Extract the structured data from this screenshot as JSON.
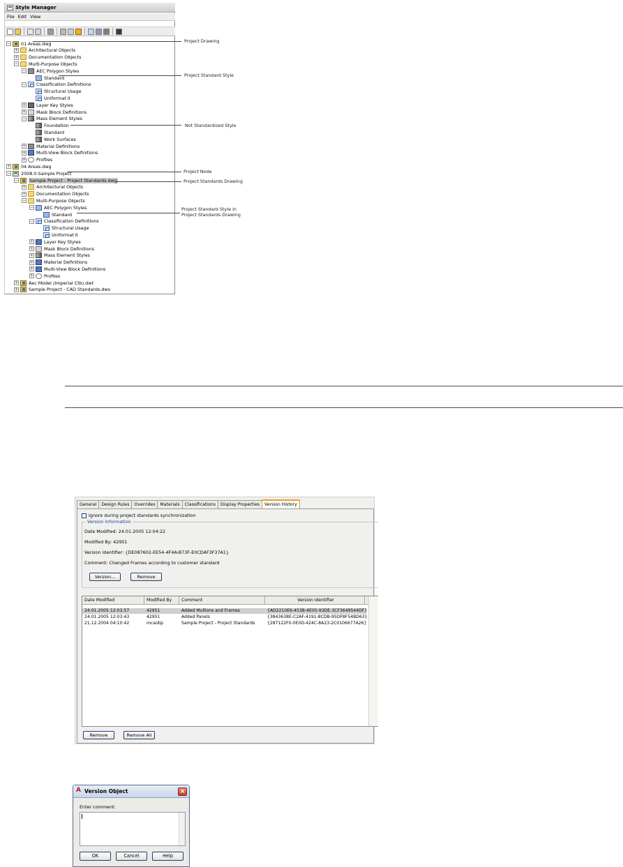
{
  "style_manager": {
    "title": "Style Manager",
    "menu": [
      "File",
      "Edit",
      "View"
    ],
    "tree": [
      {
        "label": "01 Areas.dwg",
        "level": 0,
        "expander": "−",
        "icon": "drawing"
      },
      {
        "label": "Architectural Objects",
        "level": 1,
        "expander": "+",
        "icon": "folder"
      },
      {
        "label": "Documentation Objects",
        "level": 1,
        "expander": "+",
        "icon": "folder"
      },
      {
        "label": "Multi-Purpose Objects",
        "level": 1,
        "expander": "−",
        "icon": "folder"
      },
      {
        "label": "AEC Polygon Styles",
        "level": 2,
        "expander": "−",
        "icon": "grey"
      },
      {
        "label": "Standard",
        "level": 3,
        "expander": "",
        "icon": "style"
      },
      {
        "label": "Classification Definitions",
        "level": 2,
        "expander": "−",
        "icon": "class"
      },
      {
        "label": "Structural Usage",
        "level": 3,
        "expander": "",
        "icon": "class"
      },
      {
        "label": "Uniformat II",
        "level": 3,
        "expander": "",
        "icon": "class"
      },
      {
        "label": "Layer Key Styles",
        "level": 2,
        "expander": "+",
        "icon": "layer"
      },
      {
        "label": "Mask Block Definitions",
        "level": 2,
        "expander": "+",
        "icon": "mask"
      },
      {
        "label": "Mass Element Styles",
        "level": 2,
        "expander": "−",
        "icon": "mass"
      },
      {
        "label": "Foundation",
        "level": 3,
        "expander": "",
        "icon": "mass"
      },
      {
        "label": "Standard",
        "level": 3,
        "expander": "",
        "icon": "mass"
      },
      {
        "label": "Work Surfaces",
        "level": 3,
        "expander": "",
        "icon": "mass"
      },
      {
        "label": "Material Definitions",
        "level": 2,
        "expander": "+",
        "icon": "grey"
      },
      {
        "label": "Multi-View Block Definitions",
        "level": 2,
        "expander": "+",
        "icon": "mv"
      },
      {
        "label": "Profiles",
        "level": 2,
        "expander": "+",
        "icon": "profile"
      },
      {
        "label": "04 Areas.dwg",
        "level": 0,
        "expander": "+",
        "icon": "drawing"
      },
      {
        "label": "2008.0-Sample Project",
        "level": 0,
        "expander": "−",
        "icon": "project"
      },
      {
        "label": "Sample Project - Project Standards.dwg",
        "level": 1,
        "expander": "−",
        "icon": "drawing",
        "selected": true
      },
      {
        "label": "Architectural Objects",
        "level": 2,
        "expander": "+",
        "icon": "folder"
      },
      {
        "label": "Documentation Objects",
        "level": 2,
        "expander": "+",
        "icon": "folder"
      },
      {
        "label": "Multi-Purpose Objects",
        "level": 2,
        "expander": "−",
        "icon": "folder"
      },
      {
        "label": "AEC Polygon Styles",
        "level": 3,
        "expander": "−",
        "icon": "style"
      },
      {
        "label": "Standard",
        "level": 4,
        "expander": "",
        "icon": "style"
      },
      {
        "label": "Classification Definitions",
        "level": 3,
        "expander": "−",
        "icon": "class"
      },
      {
        "label": "Structural Usage",
        "level": 4,
        "expander": "",
        "icon": "class"
      },
      {
        "label": "Uniformat II",
        "level": 4,
        "expander": "",
        "icon": "class"
      },
      {
        "label": "Layer Key Styles",
        "level": 3,
        "expander": "+",
        "icon": "mv"
      },
      {
        "label": "Mask Block Definitions",
        "level": 3,
        "expander": "+",
        "icon": "mask"
      },
      {
        "label": "Mass Element Styles",
        "level": 3,
        "expander": "+",
        "icon": "mass"
      },
      {
        "label": "Material Definitions",
        "level": 3,
        "expander": "+",
        "icon": "mv"
      },
      {
        "label": "Multi-View Block Definitions",
        "level": 3,
        "expander": "+",
        "icon": "mv"
      },
      {
        "label": "Profiles",
        "level": 3,
        "expander": "+",
        "icon": "profile"
      },
      {
        "label": "Aec Model (Imperial Ctb).dwt",
        "level": 1,
        "expander": "+",
        "icon": "drawing"
      },
      {
        "label": "Sample Project - CAD Standards.dws",
        "level": 1,
        "expander": "+",
        "icon": "drawing"
      }
    ],
    "callouts": {
      "project_drawing": "Project Drawing",
      "project_standard_style": "Project Standard Style",
      "not_standardized_style": "Not Standardized Style",
      "project_node": "Project Node",
      "project_standards_drawing": "Project Standards Drawing",
      "style_in_standards_1": "Project Standard Style in",
      "style_in_standards_2": "Project Standards Drawing"
    }
  },
  "version_history": {
    "tabs": [
      "General",
      "Design Rules",
      "Overrides",
      "Materials",
      "Classifications",
      "Display Properties",
      "Version History"
    ],
    "active_tab": "Version History",
    "ignore_checkbox": "Ignore during project standards synchronization",
    "group_title": "Version Information",
    "date_modified": "Date Modified: 24.01.2005 12:04:22",
    "modified_by": "Modified By: 42951",
    "version_identifier": "Version Identifier: {DE087602-EE54-4F4A-B73F-E0CDAF3F37A1}",
    "comment": "Comment: Changed Frames according to customer standard",
    "version_button": "Version...",
    "remove_button": "Remove",
    "columns": [
      "Date Modified",
      "Modified By",
      "Comment",
      "Version Identifier"
    ],
    "rows": [
      {
        "date": "24.01.2005 12:03:57",
        "by": "42951",
        "comment": "Added Mullions and Frames",
        "id": "{AD2210E6-453B-4E05-93DE-3CF3649544DF}",
        "selected": true
      },
      {
        "date": "24.01.2005 12:03:43",
        "by": "42951",
        "comment": "Added Panels",
        "id": "{3843638E-C2AF-4191-8CDB-95DF8F54BD63}"
      },
      {
        "date": "21.12.2004 04:10:42",
        "by": "mcaidip",
        "comment": "Sample Project - Project Standards",
        "id": "{287122F0-0E0D-424C-8A23-2C0106677A26}"
      }
    ],
    "bottom_remove": "Remove",
    "bottom_remove_all": "Remove All"
  },
  "version_object": {
    "title": "Version Object",
    "label": "Enter comment:",
    "comment_value": "",
    "ok": "OK",
    "cancel": "Cancel",
    "help": "Help"
  }
}
